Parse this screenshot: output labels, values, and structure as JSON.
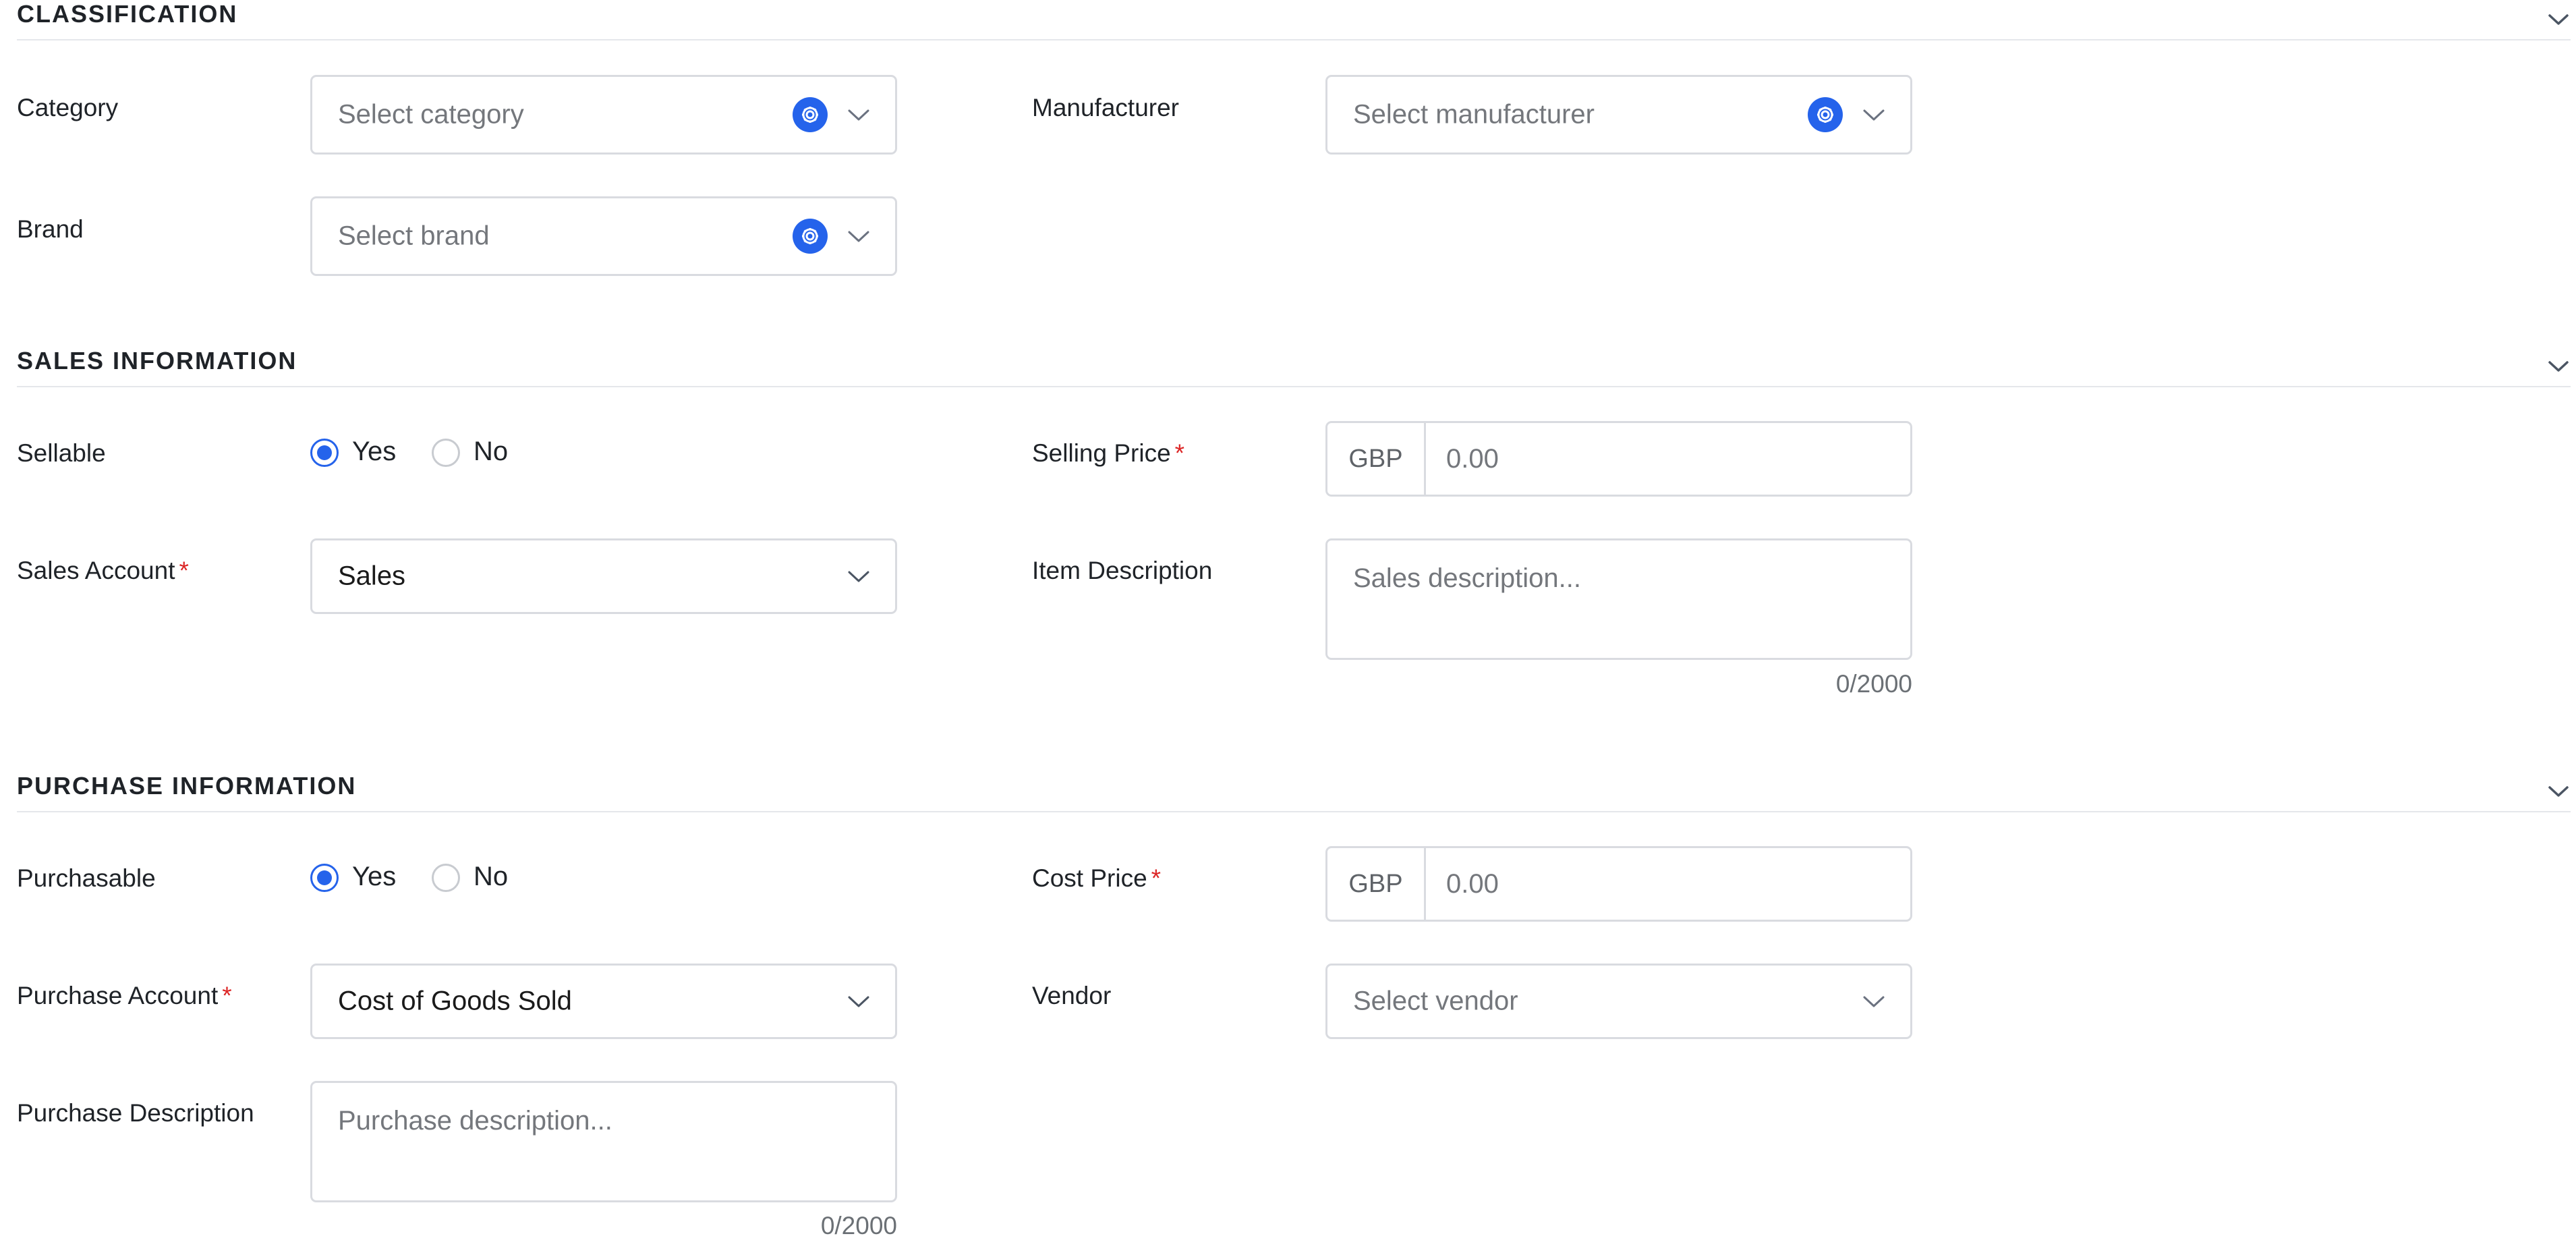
{
  "classification": {
    "title": "CLASSIFICATION",
    "category_label": "Category",
    "category_placeholder": "Select category",
    "brand_label": "Brand",
    "brand_placeholder": "Select brand",
    "manufacturer_label": "Manufacturer",
    "manufacturer_placeholder": "Select manufacturer"
  },
  "sales": {
    "title": "SALES INFORMATION",
    "sellable_label": "Sellable",
    "yes_label": "Yes",
    "no_label": "No",
    "sellable_value": "Yes",
    "sales_account_label": "Sales Account",
    "sales_account_value": "Sales",
    "selling_price_label": "Selling Price",
    "currency": "GBP",
    "selling_price_placeholder": "0.00",
    "item_description_label": "Item Description",
    "item_description_placeholder": "Sales description...",
    "item_description_counter": "0/2000"
  },
  "purchase": {
    "title": "PURCHASE INFORMATION",
    "purchasable_label": "Purchasable",
    "yes_label": "Yes",
    "no_label": "No",
    "purchasable_value": "Yes",
    "purchase_account_label": "Purchase Account",
    "purchase_account_value": "Cost of Goods Sold",
    "purchase_description_label": "Purchase Description",
    "purchase_description_placeholder": "Purchase description...",
    "purchase_description_counter": "0/2000",
    "cost_price_label": "Cost Price",
    "currency": "GBP",
    "cost_price_placeholder": "0.00",
    "vendor_label": "Vendor",
    "vendor_placeholder": "Select vendor"
  },
  "required_marker": "*",
  "colors": {
    "accent": "#2563eb",
    "required": "#dc2626",
    "border": "#d9dbe0"
  },
  "icons": {
    "settings": "gear-icon",
    "expand": "chevron-down-icon"
  }
}
